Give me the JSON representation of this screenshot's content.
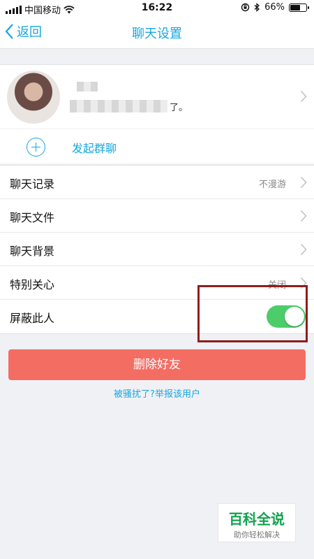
{
  "status_bar": {
    "carrier": "中国移动",
    "time": "16:22",
    "battery": "66%",
    "battery_level": 0.66
  },
  "header": {
    "back_label": "返回",
    "title": "聊天设置"
  },
  "profile": {
    "signature_end": "了。"
  },
  "group_chat": {
    "label": "发起群聊"
  },
  "settings": [
    {
      "label": "聊天记录",
      "value": "不漫游"
    },
    {
      "label": "聊天文件",
      "value": ""
    },
    {
      "label": "聊天背景",
      "value": ""
    },
    {
      "label": "特别关心",
      "value": "关闭"
    },
    {
      "label": "屏蔽此人",
      "toggle_on": true
    }
  ],
  "actions": {
    "delete_label": "删除好友",
    "report_label": "被骚扰了?举报该用户"
  },
  "watermark": {
    "title": "百科全说",
    "subtitle": "助你轻松解决"
  },
  "colors": {
    "accent": "#16a7e0",
    "toggle_on": "#4ccd6a",
    "danger": "#f46d63",
    "highlight_box": "#8f1d1d"
  }
}
